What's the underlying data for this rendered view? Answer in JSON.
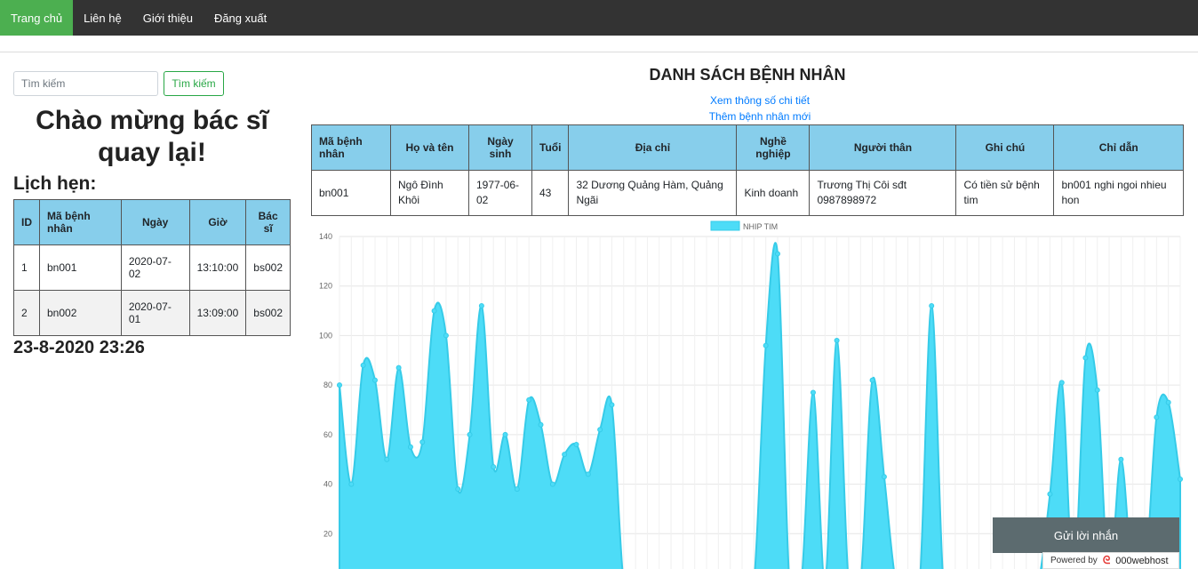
{
  "nav": {
    "items": [
      "Trang chủ",
      "Liên hệ",
      "Giới thiệu",
      "Đăng xuất"
    ],
    "active_color": "#4caf50",
    "bar_color": "#333333"
  },
  "search": {
    "placeholder": "Tìm kiếm",
    "button": "Tìm kiếm"
  },
  "welcome": "Chào mừng bác sĩ quay lại!",
  "appointments": {
    "heading": "Lịch hẹn:",
    "headers": [
      "ID",
      "Mã bệnh nhân",
      "Ngày",
      "Giờ",
      "Bác sĩ"
    ],
    "rows": [
      [
        "1",
        "bn001",
        "2020-07-02",
        "13:10:00",
        "bs002"
      ],
      [
        "2",
        "bn002",
        "2020-07-01",
        "13:09:00",
        "bs002"
      ]
    ]
  },
  "datetime": "23-8-2020 23:26",
  "patients": {
    "title": "DANH SÁCH BỆNH NHÂN",
    "link_details": "Xem thông số chi tiết",
    "link_add": "Thêm bệnh nhân mới",
    "headers": [
      "Mã bệnh nhân",
      "Họ và tên",
      "Ngày sinh",
      "Tuổi",
      "Địa chỉ",
      "Nghề nghiệp",
      "Người thân",
      "Ghi chú",
      "Chỉ dẫn"
    ],
    "rows": [
      [
        "bn001",
        "Ngô Đình Khôi",
        "1977-06-02",
        "43",
        "32 Dương Quảng Hàm, Quảng Ngãi",
        "Kinh doanh",
        "Trương Thị Côi sđt 0987898972",
        "Có tiền sử bệnh tim",
        "bn001 nghi ngoi nhieu hon"
      ]
    ],
    "header_color": "#87ceeb"
  },
  "chart_data": {
    "type": "area",
    "series": [
      {
        "name": "NHIP TIM",
        "color": "#4ddcf7",
        "values": [
          80,
          40,
          88,
          82,
          50,
          87,
          55,
          57,
          110,
          100,
          38,
          60,
          112,
          47,
          60,
          38,
          74,
          64,
          40,
          52,
          56,
          44,
          62,
          72,
          0,
          0,
          0,
          0,
          0,
          0,
          0,
          0,
          0,
          0,
          0,
          0,
          96,
          133,
          0,
          0,
          77,
          0,
          98,
          0,
          0,
          82,
          43,
          0,
          0,
          0,
          112,
          0,
          0,
          0,
          0,
          0,
          0,
          0,
          0,
          0,
          36,
          81,
          0,
          91,
          78,
          0,
          50,
          0,
          0,
          67,
          73,
          42
        ]
      }
    ],
    "ylim": [
      0,
      140
    ],
    "yticks": [
      20,
      40,
      60,
      80,
      100,
      120,
      140
    ],
    "grid": true,
    "legend": "top-center"
  },
  "chat": {
    "label": "Gửi lời nhắn"
  },
  "footer": {
    "powered": "Powered by",
    "brand": "000webhost"
  }
}
